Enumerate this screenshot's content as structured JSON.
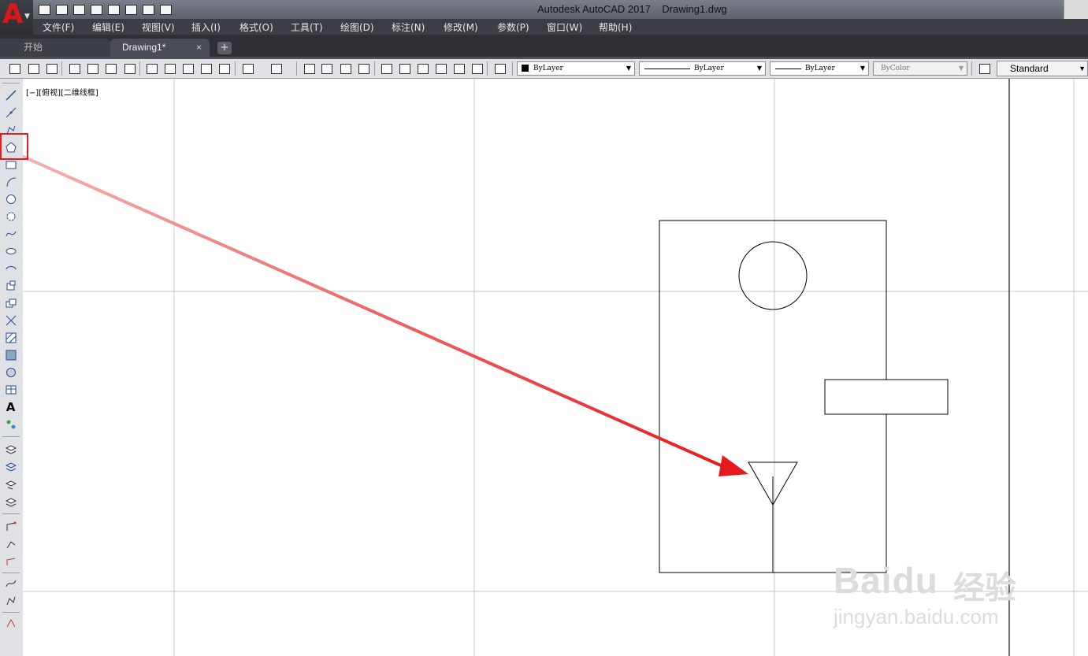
{
  "app": {
    "logo_letter": "A",
    "title": "Autodesk AutoCAD 2017    Drawing1.dwg"
  },
  "quick_access": [
    "new-icon",
    "open-icon",
    "save-icon",
    "save-as-icon",
    "plot-icon",
    "undo-icon",
    "redo-icon",
    "customize-icon"
  ],
  "menu": {
    "items": [
      "文件(F)",
      "编辑(E)",
      "视图(V)",
      "插入(I)",
      "格式(O)",
      "工具(T)",
      "绘图(D)",
      "标注(N)",
      "修改(M)",
      "参数(P)",
      "窗口(W)",
      "帮助(H)"
    ]
  },
  "tabs": {
    "start": "开始",
    "drawing": "Drawing1*",
    "close": "×",
    "add": "+"
  },
  "properties": {
    "color": "ByLayer",
    "linetype": "ByLayer",
    "lineweight": "ByLayer",
    "plotstyle": "ByColor",
    "text_style": "Standard"
  },
  "viewport": {
    "label": "[−][俯视][二维线框]"
  },
  "watermark": {
    "brand": "Baidu",
    "cn": "经验",
    "url": "jingyan.baidu.com"
  },
  "colors": {
    "highlight": "#e02020",
    "arrow": "#e8191c",
    "app_logo": "#e0141b"
  }
}
